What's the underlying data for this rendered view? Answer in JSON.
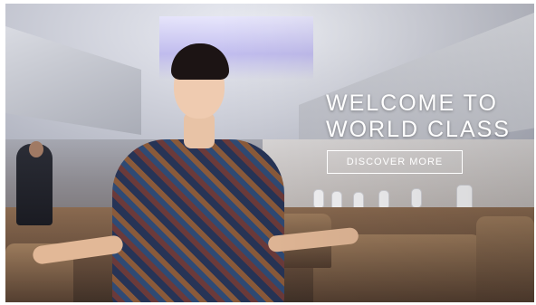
{
  "hero": {
    "headline_line1": "WELCOME TO",
    "headline_line2": "WORLD CLASS",
    "cta_label": "DISCOVER MORE",
    "image_subject": "flight attendant in aircraft cabin"
  },
  "colors": {
    "text": "#ffffff",
    "cta_border": "#ffffff"
  }
}
